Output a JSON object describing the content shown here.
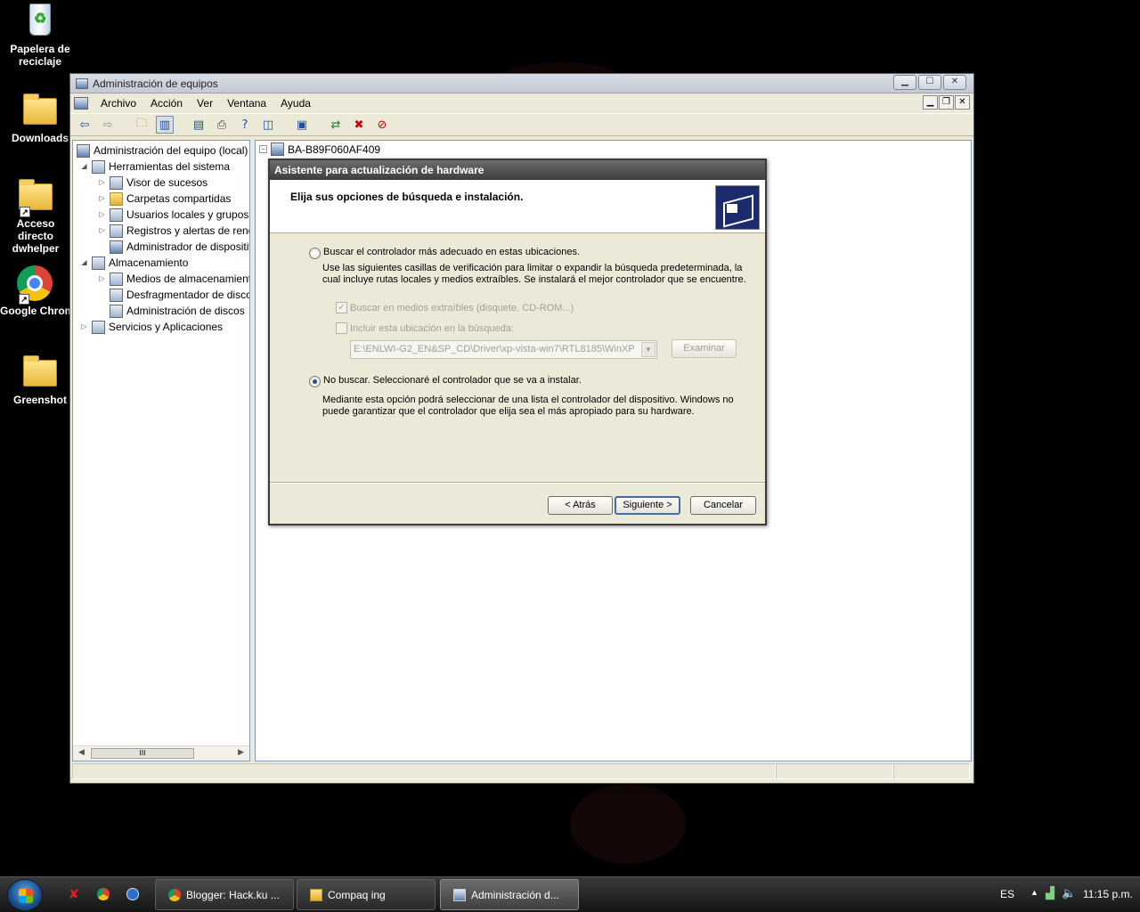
{
  "desktop": {
    "icons": [
      {
        "label": "Papelera de reciclaje"
      },
      {
        "label": "Downloads"
      },
      {
        "label": "Acceso directo dwhelper"
      },
      {
        "label": "Google Chrome"
      },
      {
        "label": "Greenshot"
      }
    ]
  },
  "window": {
    "title": "Administración de equipos",
    "controls": {
      "minimize": "▁",
      "maximize": "☐",
      "close": "✕"
    },
    "menu": [
      "Archivo",
      "Acción",
      "Ver",
      "Ventana",
      "Ayuda"
    ],
    "mdi_controls": {
      "minimize": "▁",
      "restore": "❐",
      "close": "✕"
    },
    "toolbar_icons": [
      "back-arrow-icon",
      "forward-arrow-icon",
      "up-folder-icon",
      "show-hide-tree-icon",
      "properties-icon",
      "print-icon",
      "help-icon",
      "show-hide-action-pane-icon",
      "scan-hardware-icon",
      "update-driver-icon",
      "uninstall-icon",
      "disable-device-icon"
    ]
  },
  "tree": {
    "root": "Administración del equipo (local)",
    "items": [
      {
        "label": "Herramientas del sistema"
      },
      {
        "label": "Visor de sucesos"
      },
      {
        "label": "Carpetas compartidas"
      },
      {
        "label": "Usuarios locales y grupos"
      },
      {
        "label": "Registros y alertas de rendimiento"
      },
      {
        "label": "Administrador de dispositivos"
      },
      {
        "label": "Almacenamiento"
      },
      {
        "label": "Medios de almacenamiento extraíbles"
      },
      {
        "label": "Desfragmentador de disco"
      },
      {
        "label": "Administración de discos"
      },
      {
        "label": "Servicios y Aplicaciones"
      }
    ],
    "scroll_thumb": "III"
  },
  "device_tree": {
    "root": "BA-B89F060AF409"
  },
  "wizard": {
    "title": "Asistente para actualización de hardware",
    "heading": "Elija sus opciones de búsqueda e instalación.",
    "option_search": {
      "label": "Buscar el controlador más adecuado en estas ubicaciones.",
      "selected": false,
      "desc_line1": "Use las siguientes casillas de verificación para limitar o expandir la búsqueda predeterminada, la",
      "desc_line2": "cual incluye rutas locales y medios extraíbles. Se instalará el mejor controlador que se encuentre."
    },
    "check_removable": {
      "label": "Buscar en medios extraíbles (disquete, CD-ROM...)",
      "checked": true
    },
    "check_location": {
      "label": "Incluir esta ubicación en la búsqueda:",
      "checked": false
    },
    "path_value": "E:\\ENLWI-G2_EN&SP_CD\\Driver\\xp-vista-win7\\RTL8185\\WinXP",
    "browse_label": "Examinar",
    "option_nosearch": {
      "label": "No buscar. Seleccionaré el controlador que se va a instalar.",
      "selected": true,
      "desc_line1": "Mediante esta opción podrá seleccionar de una lista el controlador del dispositivo. Windows no",
      "desc_line2": "puede garantizar que el controlador que elija sea el más apropiado para su hardware."
    },
    "buttons": {
      "back": "< Atrás",
      "next": "Siguiente >",
      "cancel": "Cancelar"
    }
  },
  "taskbar": {
    "tasks": [
      {
        "label": "Blogger: Hack.ku ..."
      },
      {
        "label": "Compaq ing"
      },
      {
        "label": "Administración d..."
      }
    ],
    "language": "ES",
    "clock": "11:15 p.m."
  }
}
